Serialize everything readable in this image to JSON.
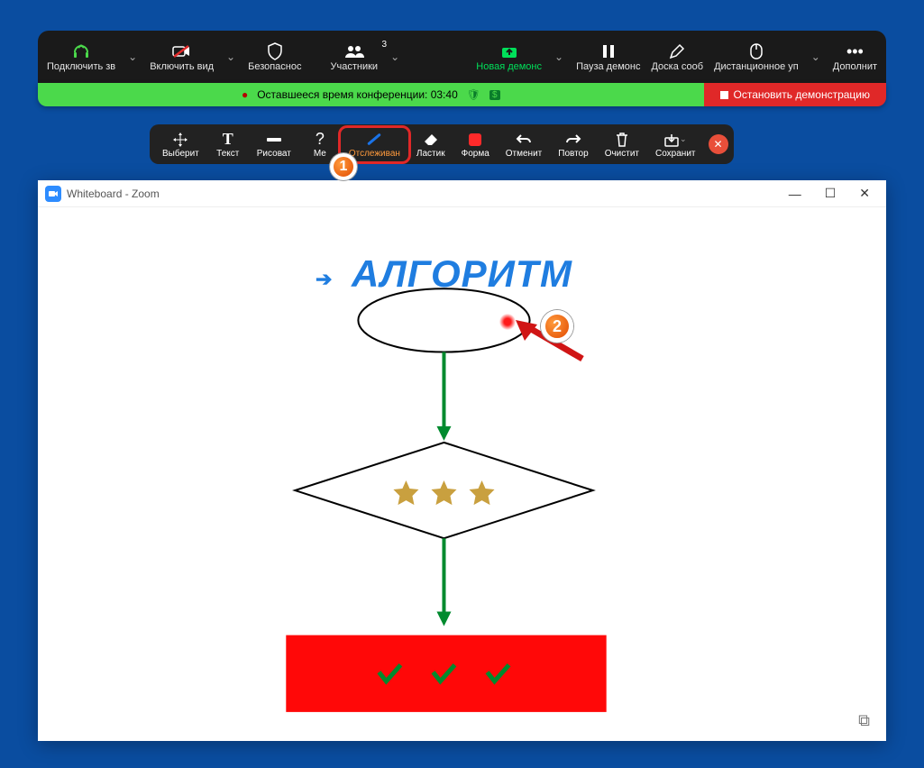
{
  "topbar": {
    "audio": "Подключить зв",
    "video": "Включить вид",
    "security": "Безопаснос",
    "participants": "Участники",
    "participants_badge": "3",
    "newshare": "Новая демонс",
    "pause": "Пауза демонс",
    "board": "Доска сооб",
    "remote": "Дистанционное уп",
    "more": "Дополнит"
  },
  "status": {
    "remaining": "Оставшееся время конференции: 03:40",
    "stop": "Остановить демонстрацию"
  },
  "annobar": {
    "select": "Выберит",
    "text": "Текст",
    "draw": "Рисоват",
    "stamp": "Ме",
    "spotlight": "Отслеживан",
    "eraser": "Ластик",
    "format": "Форма",
    "undo": "Отменит",
    "redo": "Повтор",
    "clear": "Очистит",
    "save": "Сохранит"
  },
  "callouts": {
    "n1": "1",
    "n2": "2"
  },
  "window": {
    "title": "Whiteboard - Zoom"
  },
  "whiteboard": {
    "heading": "АЛГОРИТМ"
  }
}
